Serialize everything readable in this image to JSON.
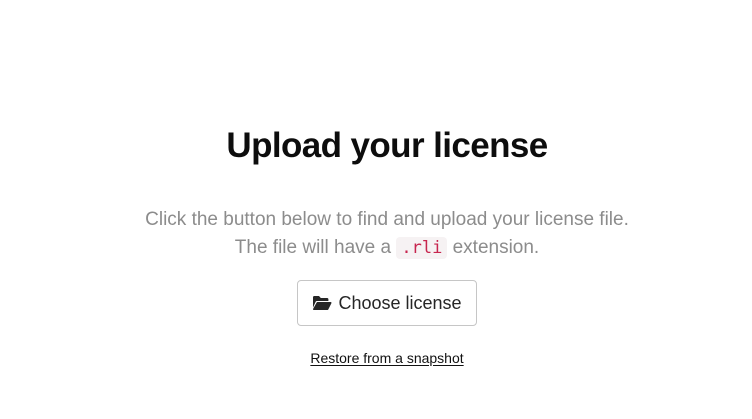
{
  "page": {
    "title": "Upload your license",
    "description_line1": "Click the button below to find and upload your license file.",
    "description_line2_prefix": "The file will have a",
    "extension": ".rli",
    "description_line2_suffix": "extension."
  },
  "actions": {
    "choose_label": "Choose license",
    "choose_icon": "folder-open-icon",
    "restore_label": "Restore from a snapshot"
  },
  "colors": {
    "code_text": "#c7254e",
    "code_background": "#f6f2f3",
    "muted_text": "#8c8c8c"
  }
}
